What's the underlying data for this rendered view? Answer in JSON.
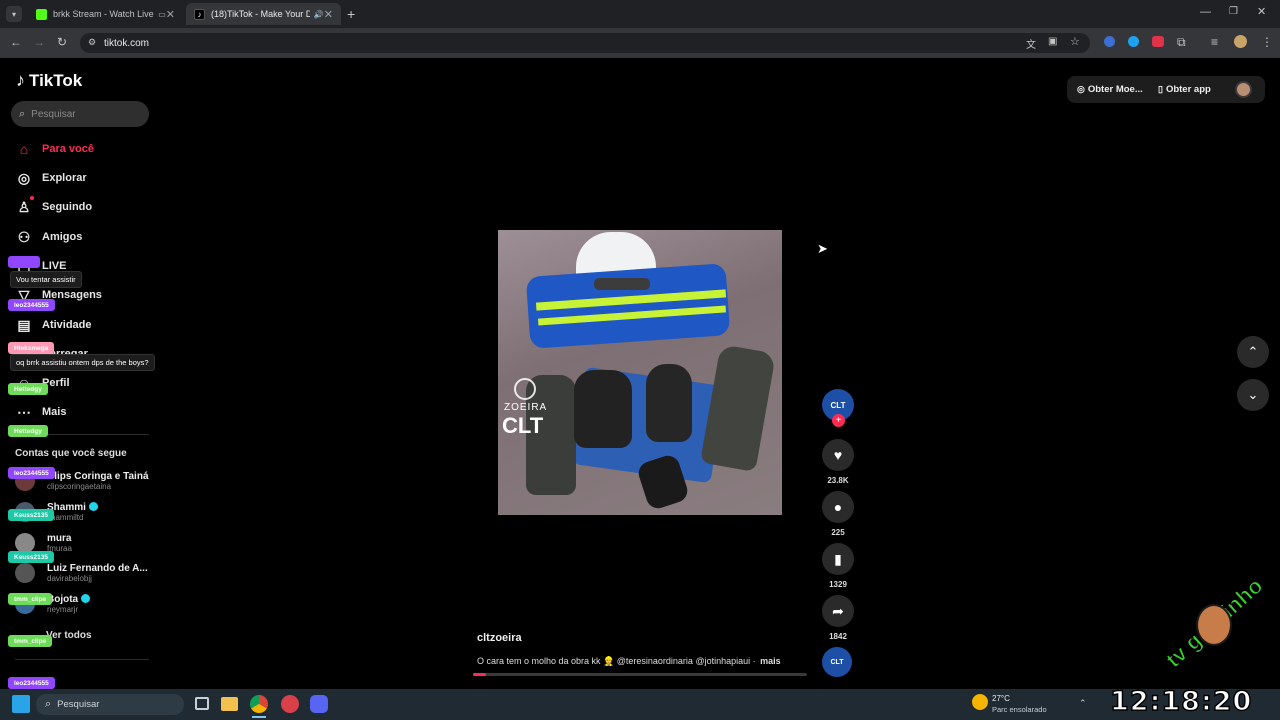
{
  "browser": {
    "tabs": [
      {
        "title": "brkk Stream - Watch Live o",
        "active": false
      },
      {
        "title": "(18)TikTok - Make Your Day",
        "active": true
      }
    ],
    "address": "tiktok.com"
  },
  "tiktok": {
    "logo_text": "TikTok",
    "search_placeholder": "Pesquisar",
    "nav": [
      {
        "label": "Para você",
        "icon": "home-icon",
        "active": true
      },
      {
        "label": "Explorar",
        "icon": "compass-icon"
      },
      {
        "label": "Seguindo",
        "icon": "following-icon"
      },
      {
        "label": "Amigos",
        "icon": "friends-icon"
      },
      {
        "label": "LIVE",
        "icon": "live-icon"
      },
      {
        "label": "Mensagens",
        "icon": "messages-icon"
      },
      {
        "label": "Atividade",
        "icon": "activity-icon"
      },
      {
        "label": "Carregar",
        "icon": "upload-icon"
      },
      {
        "label": "Perfil",
        "icon": "profile-icon"
      },
      {
        "label": "Mais",
        "icon": "more-icon"
      }
    ],
    "following_title": "Contas que você segue",
    "accounts": [
      {
        "name": "Clips Coringa e Tainá",
        "handle": "clipscoringaetaina",
        "verified": false
      },
      {
        "name": "Shammi",
        "handle": "shammiltd",
        "verified": true
      },
      {
        "name": "mura",
        "handle": "fmuraa",
        "verified": false
      },
      {
        "name": "Luiz Fernando de A...",
        "handle": "davirabelobjj",
        "verified": false
      },
      {
        "name": "Bojota",
        "handle": "neymarjr",
        "verified": true
      }
    ],
    "see_all": "Ver todos",
    "top_right": {
      "coins": "Obter Moe...",
      "app": "Obter app"
    },
    "video": {
      "watermark_top": "ZOEIRA",
      "watermark_bottom": "CLT",
      "author": "cltzoeira",
      "caption": "O cara tem o molho da obra kk 👷 @teresinaordinaria @jotinhapiaui ·",
      "more": "mais",
      "progress_pct": 4
    },
    "actions": {
      "likes": "23.8K",
      "comments": "225",
      "saves": "1329",
      "shares": "1842"
    }
  },
  "chat": {
    "items": [
      {
        "user": "",
        "color": "#9147ff",
        "msg": "Vou tentar assistir"
      },
      {
        "user": "leo2344555",
        "color": "#9147ff",
        "msg": ""
      },
      {
        "user": "Hleksmega",
        "color": "#ff99b4",
        "msg": "oq brrk assistiu ontem dps de the boys?"
      },
      {
        "user": "Hettedgy",
        "color": "#6edc5a",
        "msg": ""
      },
      {
        "user": "Hettedgy",
        "color": "#6edc5a",
        "msg": ""
      },
      {
        "user": "leo2344555",
        "color": "#9147ff",
        "msg": ""
      },
      {
        "user": "Keuss2135",
        "color": "#1dc9a6",
        "msg": ""
      },
      {
        "user": "Keuss2135",
        "color": "#1dc9a6",
        "msg": ""
      },
      {
        "user": "tmm_clipe",
        "color": "#6edc5a",
        "msg": ""
      },
      {
        "user": "tmm_clipe",
        "color": "#6edc5a",
        "msg": ""
      },
      {
        "user": "leo2344555",
        "color": "#9147ff",
        "msg": ""
      }
    ]
  },
  "taskbar": {
    "search": "Pesquisar",
    "weather_temp": "27°C",
    "weather_desc": "Parc ensolarado",
    "clock": "12:18:20"
  },
  "overlay": {
    "brand": "tv gordinho"
  }
}
